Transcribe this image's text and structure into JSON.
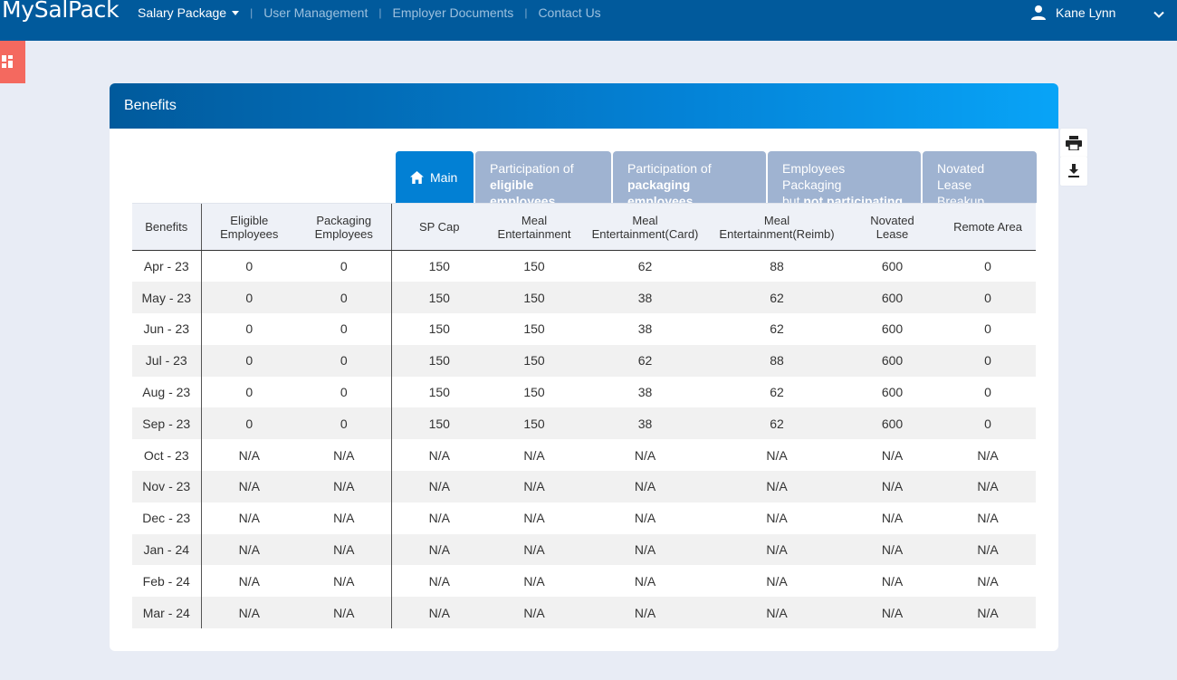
{
  "app": {
    "logo": "MySalPack"
  },
  "nav": {
    "items": [
      {
        "label": "Salary Package",
        "has_dropdown": true,
        "active": true
      },
      {
        "label": "User Management"
      },
      {
        "label": "Employer Documents"
      },
      {
        "label": "Contact Us"
      }
    ]
  },
  "user": {
    "name": "Kane Lynn"
  },
  "card": {
    "title": "Benefits"
  },
  "tabs": [
    {
      "label": "Main",
      "active": true
    },
    {
      "line1": "Participation of",
      "line2": "eligible employees"
    },
    {
      "line1": "Participation of",
      "line2": "packaging employees"
    },
    {
      "line1": "Employees Packaging",
      "line2_pre": "but ",
      "line2": "not participating"
    },
    {
      "line1": "Novated Lease",
      "line2": "Breakup"
    }
  ],
  "table": {
    "headers": [
      [
        "Benefits"
      ],
      [
        "Eligible",
        "Employees"
      ],
      [
        "Packaging",
        "Employees"
      ],
      [
        "SP Cap"
      ],
      [
        "Meal",
        "Entertainment"
      ],
      [
        "Meal",
        "Entertainment(Card)"
      ],
      [
        "Meal",
        "Entertainment(Reimb)"
      ],
      [
        "Novated",
        "Lease"
      ],
      [
        "Remote Area"
      ]
    ],
    "rows": [
      [
        "Apr - 23",
        "0",
        "0",
        "150",
        "150",
        "62",
        "88",
        "600",
        "0"
      ],
      [
        "May - 23",
        "0",
        "0",
        "150",
        "150",
        "38",
        "62",
        "600",
        "0"
      ],
      [
        "Jun - 23",
        "0",
        "0",
        "150",
        "150",
        "38",
        "62",
        "600",
        "0"
      ],
      [
        "Jul - 23",
        "0",
        "0",
        "150",
        "150",
        "62",
        "88",
        "600",
        "0"
      ],
      [
        "Aug - 23",
        "0",
        "0",
        "150",
        "150",
        "38",
        "62",
        "600",
        "0"
      ],
      [
        "Sep - 23",
        "0",
        "0",
        "150",
        "150",
        "38",
        "62",
        "600",
        "0"
      ],
      [
        "Oct - 23",
        "N/A",
        "N/A",
        "N/A",
        "N/A",
        "N/A",
        "N/A",
        "N/A",
        "N/A"
      ],
      [
        "Nov - 23",
        "N/A",
        "N/A",
        "N/A",
        "N/A",
        "N/A",
        "N/A",
        "N/A",
        "N/A"
      ],
      [
        "Dec - 23",
        "N/A",
        "N/A",
        "N/A",
        "N/A",
        "N/A",
        "N/A",
        "N/A",
        "N/A"
      ],
      [
        "Jan - 24",
        "N/A",
        "N/A",
        "N/A",
        "N/A",
        "N/A",
        "N/A",
        "N/A",
        "N/A"
      ],
      [
        "Feb - 24",
        "N/A",
        "N/A",
        "N/A",
        "N/A",
        "N/A",
        "N/A",
        "N/A",
        "N/A"
      ],
      [
        "Mar - 24",
        "N/A",
        "N/A",
        "N/A",
        "N/A",
        "N/A",
        "N/A",
        "N/A",
        "N/A"
      ]
    ]
  },
  "colors": {
    "topbar": "#015a9c",
    "accent": "#0280d4",
    "tab_inactive": "#9fb3d1",
    "side_toggle": "#f4695f",
    "page_bg": "#e8ecf5"
  },
  "icons": {
    "user": "user-icon",
    "chevron": "chevron-down-icon",
    "grid": "grid-icon",
    "home": "home-icon",
    "print": "print-icon",
    "download": "download-icon"
  }
}
